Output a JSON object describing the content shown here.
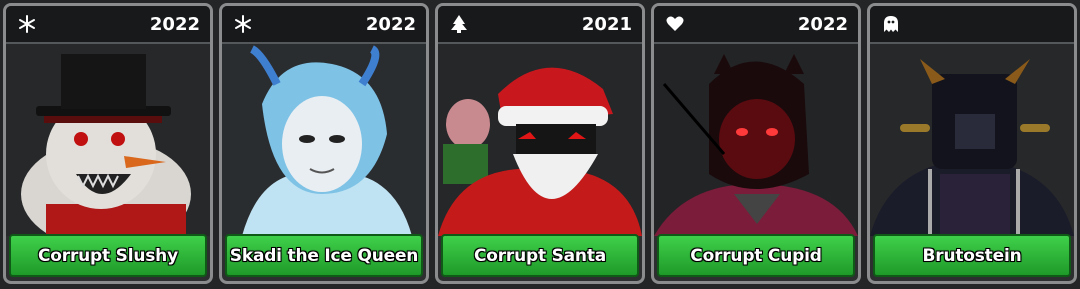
{
  "cards": [
    {
      "year": "2022",
      "icon": "snowflake-icon",
      "name": "Corrupt Slushy"
    },
    {
      "year": "2022",
      "icon": "snowflake-icon",
      "name": "Skadi the Ice Queen"
    },
    {
      "year": "2021",
      "icon": "christmas-tree-icon",
      "name": "Corrupt Santa"
    },
    {
      "year": "2022",
      "icon": "heart-icon",
      "name": "Corrupt Cupid"
    },
    {
      "year": "",
      "icon": "ghost-icon",
      "name": "Brutostein"
    }
  ],
  "colors": {
    "button_green": "#2eb83a",
    "card_border": "#8a8c8e",
    "header_bg": "#17191b"
  }
}
